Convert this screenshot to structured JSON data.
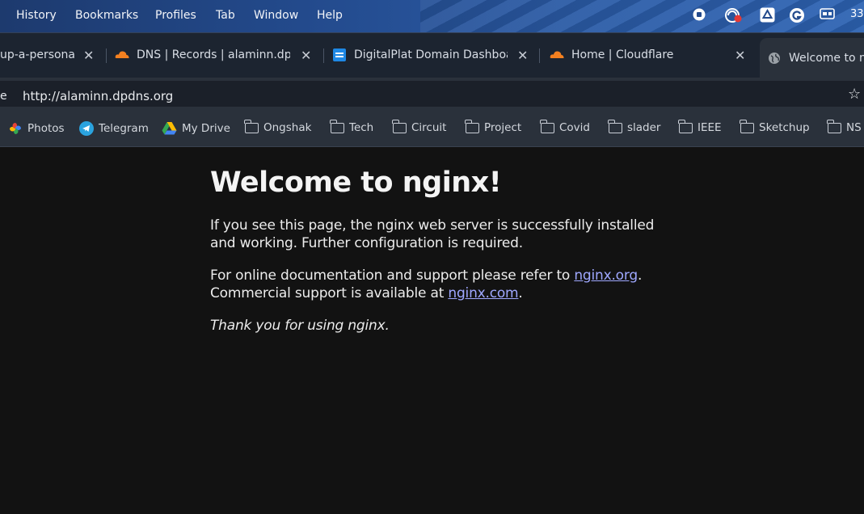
{
  "menubar": {
    "items": [
      "History",
      "Bookmarks",
      "Profiles",
      "Tab",
      "Window",
      "Help"
    ],
    "tray_text": "33"
  },
  "tabs": [
    {
      "title": "up-a-persona",
      "icon": "none"
    },
    {
      "title": "DNS | Records | alaminn.dpdn",
      "icon": "cloudflare-icon"
    },
    {
      "title": "DigitalPlat Domain Dashboard",
      "icon": "digitalplat-icon"
    },
    {
      "title": "Home | Cloudflare",
      "icon": "cloudflare-icon"
    },
    {
      "title": "Welcome to ng",
      "icon": "globe-icon"
    }
  ],
  "address": {
    "left_fragment": "e",
    "url": "http://alaminn.dpdns.org"
  },
  "bookmarks": [
    {
      "label": "Photos",
      "icon": "google-photos-icon"
    },
    {
      "label": "Telegram",
      "icon": "telegram-icon"
    },
    {
      "label": "My Drive",
      "icon": "google-drive-icon"
    },
    {
      "label": "Ongshak",
      "icon": "folder-icon"
    },
    {
      "label": "Tech",
      "icon": "folder-icon"
    },
    {
      "label": "Circuit",
      "icon": "folder-icon"
    },
    {
      "label": "Project",
      "icon": "folder-icon"
    },
    {
      "label": "Covid",
      "icon": "folder-icon"
    },
    {
      "label": "slader",
      "icon": "folder-icon"
    },
    {
      "label": "IEEE",
      "icon": "folder-icon"
    },
    {
      "label": "Sketchup",
      "icon": "folder-icon"
    },
    {
      "label": "NS",
      "icon": "folder-icon"
    }
  ],
  "page": {
    "heading": "Welcome to nginx!",
    "p1": "If you see this page, the nginx web server is successfully installed and working. Further configuration is required.",
    "p2_before": "For online documentation and support please refer to ",
    "link1": "nginx.org",
    "p2_mid": ".",
    "p2_line2": "Commercial support is available at ",
    "link2": "nginx.com",
    "p2_end": ".",
    "thanks": "Thank you for using nginx."
  },
  "colors": {
    "page_bg": "#121212",
    "link": "#9fa8ff",
    "cloudflare": "#f38020",
    "menubar": "#234a8c"
  }
}
